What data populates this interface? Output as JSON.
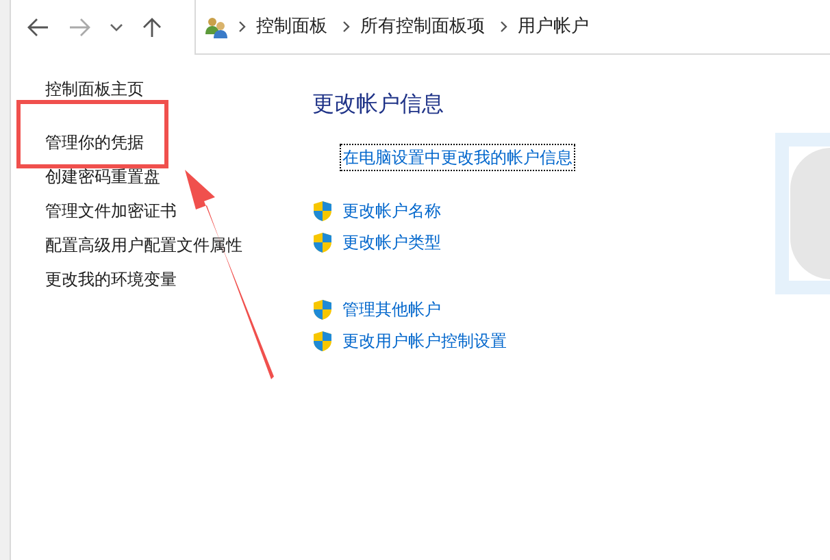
{
  "breadcrumb": [
    "控制面板",
    "所有控制面板项",
    "用户帐户"
  ],
  "sidebar": {
    "items": [
      {
        "label": "控制面板主页",
        "highlighted": false
      },
      {
        "label": "管理你的凭据",
        "highlighted": true
      },
      {
        "label": "创建密码重置盘",
        "highlighted": false
      },
      {
        "label": "管理文件加密证书",
        "highlighted": false
      },
      {
        "label": "配置高级用户配置文件属性",
        "highlighted": false
      },
      {
        "label": "更改我的环境变量",
        "highlighted": false
      }
    ]
  },
  "main": {
    "heading": "更改帐户信息",
    "link_groups": [
      [
        {
          "label": "在电脑设置中更改我的帐户信息",
          "kind": "plain",
          "focused": true
        }
      ],
      [
        {
          "label": "更改帐户名称",
          "kind": "shield",
          "focused": false
        },
        {
          "label": "更改帐户类型",
          "kind": "shield",
          "focused": false
        }
      ],
      [
        {
          "label": "管理其他帐户",
          "kind": "shield",
          "focused": false
        },
        {
          "label": "更改用户帐户控制设置",
          "kind": "shield",
          "focused": false
        }
      ]
    ]
  }
}
